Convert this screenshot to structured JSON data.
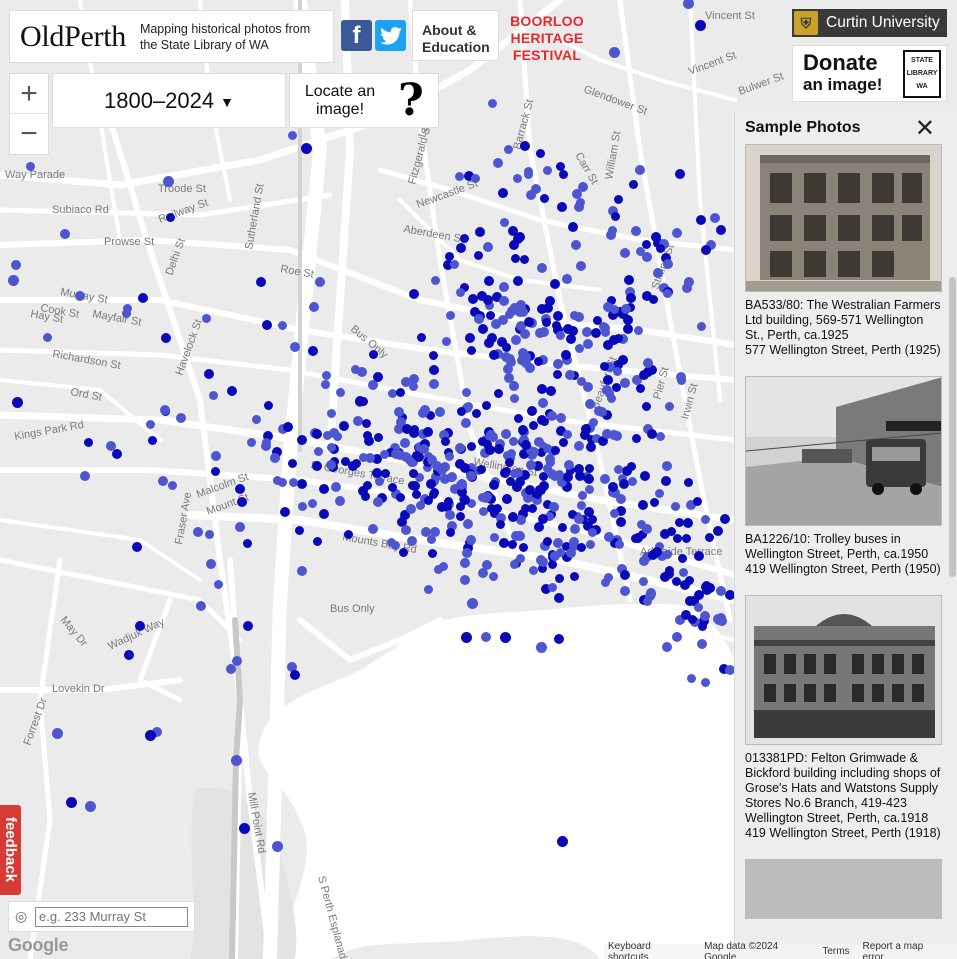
{
  "header": {
    "logo": "OldPerth",
    "subtitle": "Mapping historical photos from the State Library of WA",
    "facebook_icon": "f",
    "about": "About & Education",
    "festival": "BOORLOO HERITAGE FESTIVAL",
    "festival_color": "#e8282e"
  },
  "controls": {
    "zoom_in": "+",
    "zoom_out": "−",
    "years": "1800–2024",
    "years_caret": "▼",
    "locate": "Locate an image!",
    "help_glyph": "?"
  },
  "sponsor": {
    "curtin": "Curtin University",
    "donate_line1": "Donate",
    "donate_line2": "an image!",
    "slwa_lines": [
      "STATE",
      "LIBRARY",
      "WA"
    ]
  },
  "panel": {
    "title": "Sample Photos",
    "close": "✕",
    "photos": [
      {
        "caption": "BA533/80: The Westralian Farmers Ltd building, 569-571 Wellington St., Perth, ca.1925",
        "address": "577 Wellington Street, Perth (1925)"
      },
      {
        "caption": "BA1226/10: Trolley buses in Wellington Street, Perth, ca.1950",
        "address": "419 Wellington Street, Perth (1950)"
      },
      {
        "caption": "013381PD: Felton Grimwade & Bickford building including shops of Grose's Hats and Watstons Supply Stores No.6 Branch, 419-423 Wellington Street, Perth, ca.1918",
        "address": "419 Wellington Street, Perth (1918)"
      }
    ]
  },
  "feedback": "feedback",
  "search": {
    "placeholder": "e.g. 233 Murray St"
  },
  "map": {
    "google": "Google",
    "attribution": [
      "Keyboard shortcuts",
      "Map data ©2024 Google",
      "Terms",
      "Report a map error"
    ],
    "streets": [
      "Vincent St",
      "Vincent St",
      "Bulwer St",
      "Glendower St",
      "Carr St",
      "Way Parade",
      "Troode St",
      "Subiaco Rd",
      "Railway St",
      "Prowse St",
      "Newcastle St",
      "Aberdeen St",
      "Roe St",
      "Murray St",
      "Hay St",
      "Cook St",
      "Mayfair St",
      "Richardson St",
      "Ord St",
      "Kings Park Rd",
      "Havelock St",
      "Malcolm St",
      "Mount St",
      "Mounts Bay Rd",
      "St Georges Terrace",
      "Adelaide Terrace",
      "Wellington St",
      "Stirling St",
      "William St",
      "Beaufort St",
      "Fitzgerald St",
      "Lake St",
      "Barrack St",
      "Pier St",
      "Irwin St",
      "Bus Only",
      "Bus Only",
      "Fraser Ave",
      "May Dr",
      "Wadjuk Way",
      "Lovekin Dr",
      "Forrest Dr",
      "Mill Point Rd",
      "S Perth Esplanade",
      "Delhi St",
      "Sutherland St"
    ],
    "dot_dark": "#0909b8",
    "dot_light": "#4d56d0",
    "water": "#ffffff"
  }
}
